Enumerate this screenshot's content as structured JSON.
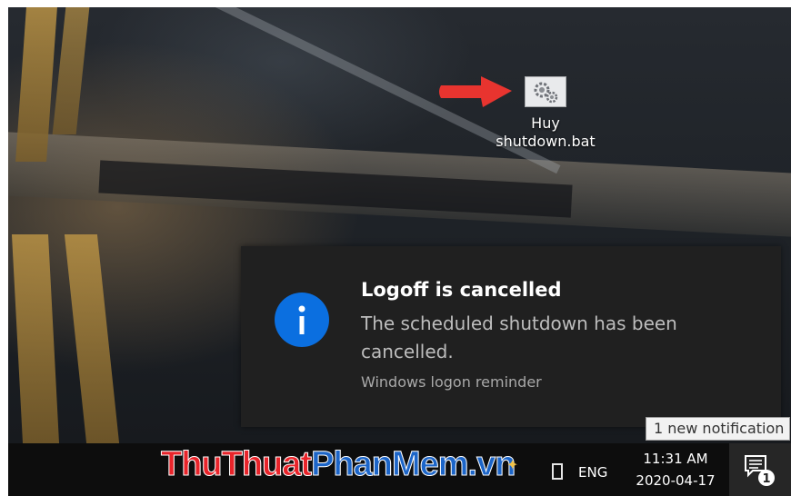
{
  "desktop": {
    "icon_label_line1": "Huy",
    "icon_label_line2": "shutdown.bat",
    "icon_name": "batch-file-gears-icon",
    "pointer_arrow_color": "#e8342f"
  },
  "notification": {
    "title": "Logoff is cancelled",
    "body": "The scheduled shutdown has been cancelled.",
    "source": "Windows logon reminder",
    "icon_name": "info-icon",
    "icon_color": "#0b6fe0"
  },
  "tooltip": {
    "text": "1 new notification"
  },
  "taskbar": {
    "watermark_part1": "ThuThuat",
    "watermark_part2": "PhanMem",
    "watermark_part3": ".vn",
    "language": "ENG",
    "time": "11:31 AM",
    "date": "2020-04-17",
    "notification_count": "1"
  }
}
